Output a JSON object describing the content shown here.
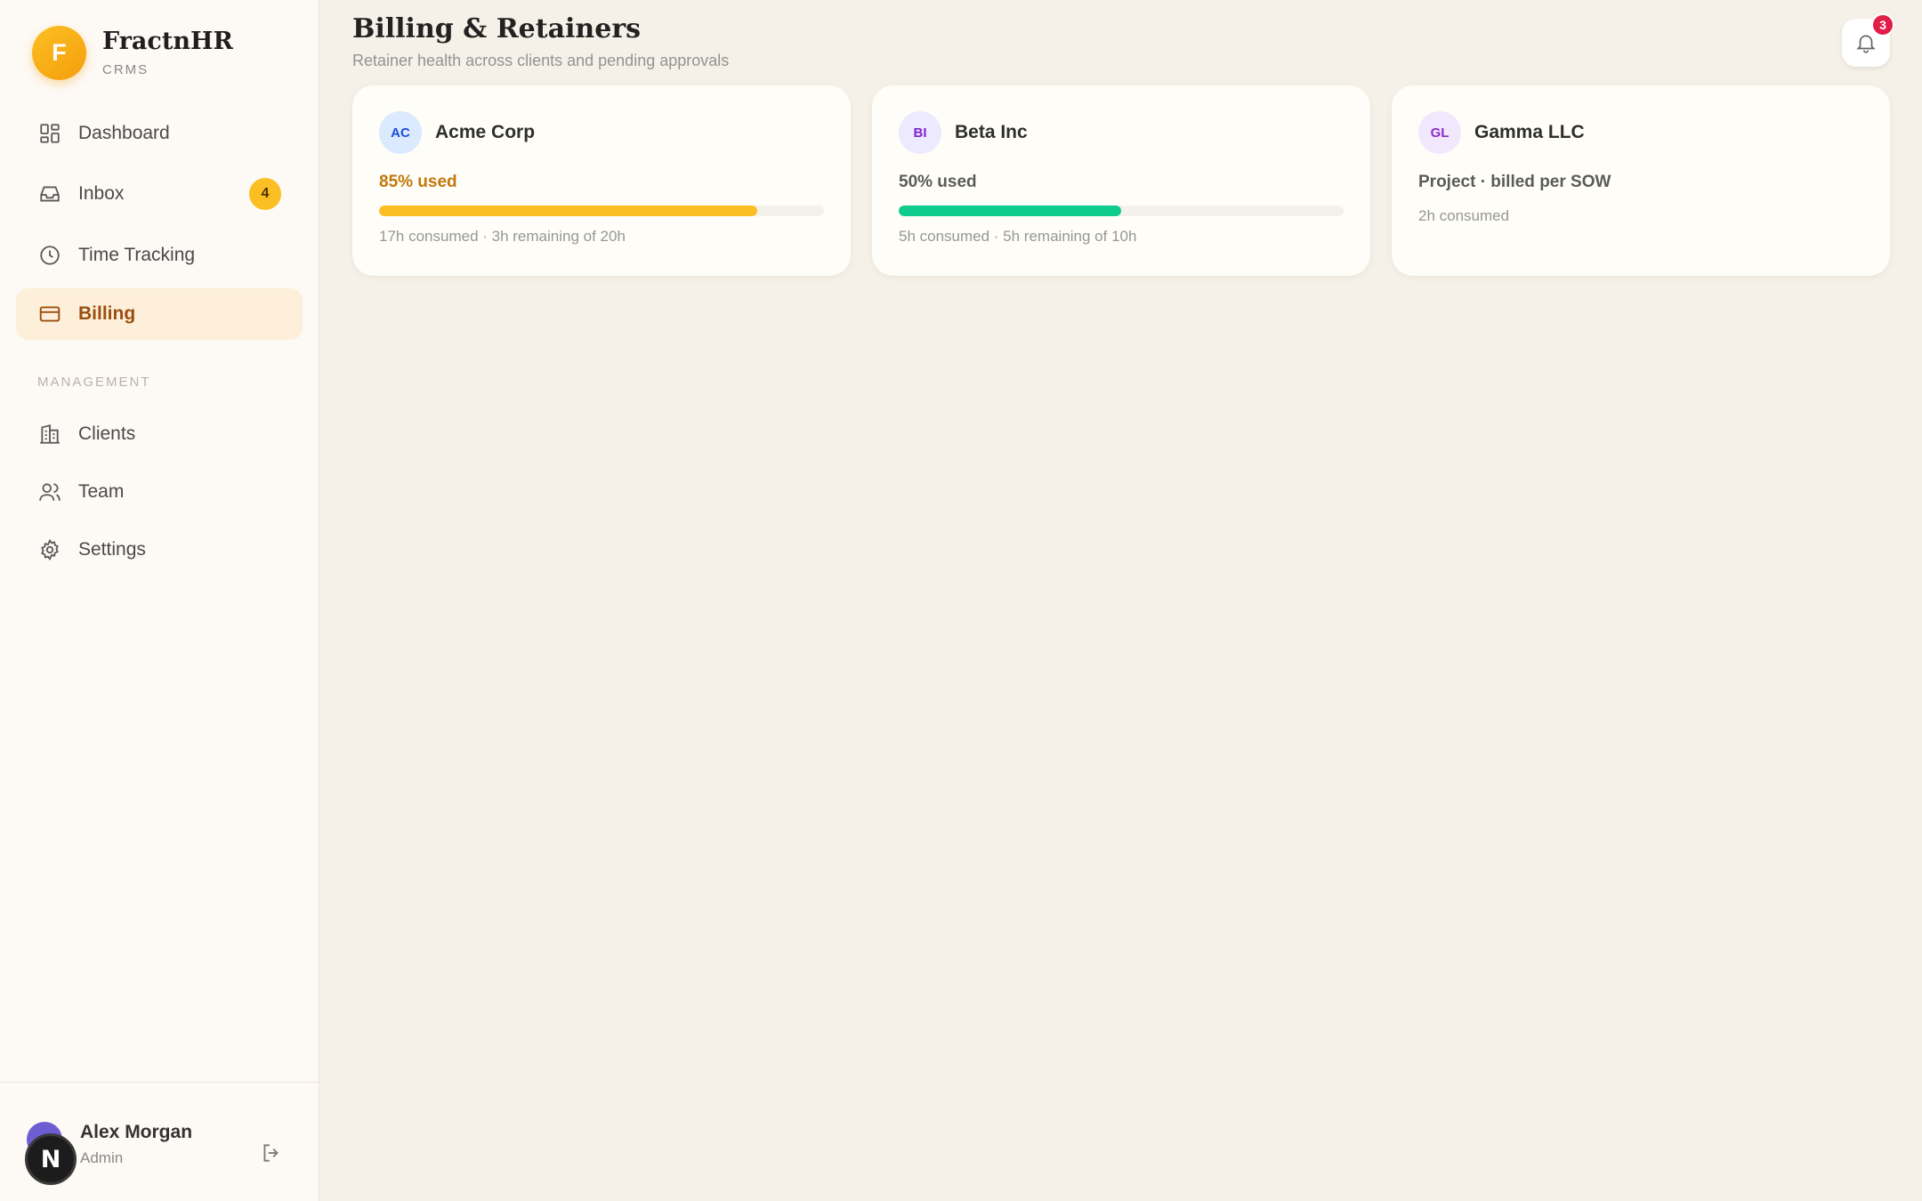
{
  "brand": {
    "logo_letter": "F",
    "name": "FractnHR",
    "subtitle": "CRMS"
  },
  "nav": {
    "items": [
      {
        "label": "Dashboard",
        "icon": "dashboard-icon"
      },
      {
        "label": "Inbox",
        "icon": "inbox-icon",
        "badge": "4"
      },
      {
        "label": "Time Tracking",
        "icon": "clock-icon"
      },
      {
        "label": "Billing",
        "icon": "credit-card-icon",
        "active": true
      }
    ],
    "section_label": "MANAGEMENT",
    "management_items": [
      {
        "label": "Clients",
        "icon": "building-icon"
      },
      {
        "label": "Team",
        "icon": "users-icon"
      },
      {
        "label": "Settings",
        "icon": "gear-icon"
      }
    ]
  },
  "user": {
    "initial": "N",
    "name": "Alex Morgan",
    "role": "Admin"
  },
  "header": {
    "title": "Billing & Retainers",
    "subtitle": "Retainer health across clients and pending approvals",
    "notifications_count": "3"
  },
  "cards": [
    {
      "initials": "AC",
      "name": "Acme Corp",
      "status": "85% used",
      "progress": 0.85,
      "detail": "17h consumed · 3h remaining of 20h",
      "colors": {
        "avatar_bg": "#dbeafe",
        "avatar_fg": "#1d4ed8",
        "status": "#c2780b",
        "fill": "#fbbf24"
      }
    },
    {
      "initials": "BI",
      "name": "Beta Inc",
      "status": "50% used",
      "progress": 0.5,
      "detail": "5h consumed · 5h remaining of 10h",
      "colors": {
        "avatar_bg": "#ede9fe",
        "avatar_fg": "#7e22ce",
        "status": "#5b5b5b",
        "fill": "#10cc8c"
      }
    },
    {
      "initials": "GL",
      "name": "Gamma LLC",
      "status": "Project · billed per SOW",
      "detail": "2h consumed",
      "colors": {
        "avatar_bg": "#f1e8fd",
        "avatar_fg": "#8b2fc9",
        "status": "#5b5b5b"
      }
    }
  ]
}
